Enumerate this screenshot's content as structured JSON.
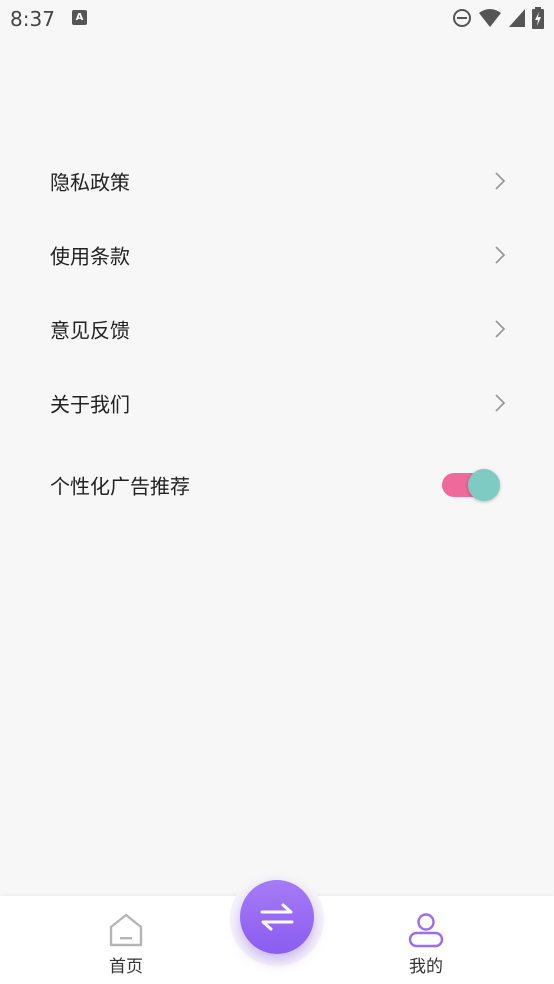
{
  "status_bar": {
    "time": "8:37",
    "notification_icon": "a-icon",
    "icons": [
      "do-not-disturb-icon",
      "wifi-icon",
      "signal-icon",
      "battery-charging-icon"
    ]
  },
  "menu": {
    "items": [
      {
        "label": "隐私政策",
        "icon": "chevron-right-icon"
      },
      {
        "label": "使用条款",
        "icon": "chevron-right-icon"
      },
      {
        "label": "意见反馈",
        "icon": "chevron-right-icon"
      },
      {
        "label": "关于我们",
        "icon": "chevron-right-icon"
      }
    ],
    "toggle": {
      "label": "个性化广告推荐",
      "on": true,
      "track_color": "#f0699b",
      "knob_color": "#7ecbc3"
    }
  },
  "tabbar": {
    "tabs": [
      {
        "label": "首页",
        "icon": "home-icon",
        "active": false
      },
      {
        "label": "我的",
        "icon": "user-icon",
        "active": true
      }
    ],
    "center_button": {
      "icon": "swap-arrows-icon",
      "color": "#9a6bf3"
    }
  }
}
